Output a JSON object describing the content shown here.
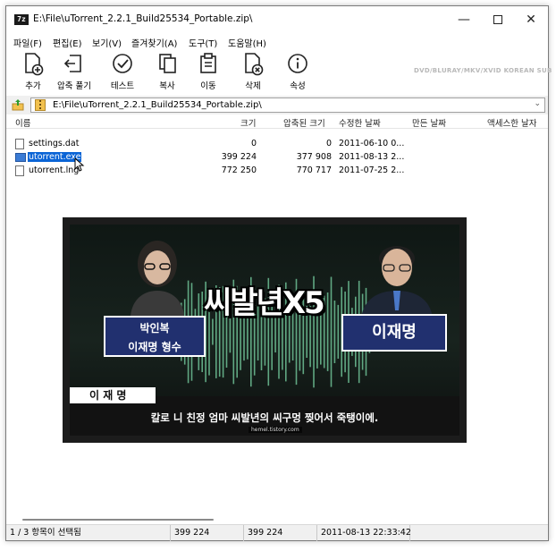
{
  "window": {
    "title": "E:\\File\\uTorrent_2.2.1_Build25534_Portable.zip\\",
    "app_icon_text": "7z",
    "minimize_glyph": "—",
    "close_glyph": "✕"
  },
  "menu": [
    "파일(F)",
    "편집(E)",
    "보기(V)",
    "즐겨찾기(A)",
    "도구(T)",
    "도움말(H)"
  ],
  "toolbar": {
    "items": [
      {
        "label": "추가",
        "icon": "add-icon"
      },
      {
        "label": "압축 풀기",
        "icon": "extract-icon"
      },
      {
        "label": "테스트",
        "icon": "test-icon"
      },
      {
        "label": "복사",
        "icon": "copy-icon"
      },
      {
        "label": "이동",
        "icon": "move-icon"
      },
      {
        "label": "삭제",
        "icon": "delete-icon"
      },
      {
        "label": "속성",
        "icon": "info-icon"
      }
    ],
    "watermark": "DVD/BLURAY/MKV/XVID KOREAN SUB"
  },
  "address": {
    "path": "E:\\File\\uTorrent_2.2.1_Build25534_Portable.zip\\",
    "dropdown_glyph": "⌄"
  },
  "columns": [
    "이름",
    "크기",
    "압축된 크기",
    "수정한 날짜",
    "만든 날짜",
    "액세스한 날자"
  ],
  "files": [
    {
      "name": "settings.dat",
      "size": "0",
      "packed": "0",
      "modified": "2011-06-10 0...",
      "selected": false,
      "icon": "file-icon"
    },
    {
      "name": "utorrent.exe",
      "size": "399 224",
      "packed": "377 908",
      "modified": "2011-08-13 2...",
      "selected": true,
      "icon": "exe-icon"
    },
    {
      "name": "utorrent.lng",
      "size": "772 250",
      "packed": "770 717",
      "modified": "2011-07-25 2...",
      "selected": false,
      "icon": "file-icon"
    }
  ],
  "status": {
    "selection": "1 / 3 항목이 선택됨",
    "size": "399 224",
    "packed": "399 224",
    "modified": "2011-08-13 22:33:42"
  },
  "thumbnail": {
    "headline": "씨발년X5",
    "left_caption_line1": "박인복",
    "left_caption_line2": "이재명 형수",
    "right_caption": "이재명",
    "name_tag": "이 재 명",
    "subtitle": "칼로 니 친정 엄마 씨발년의 씨구멍 찢어서 죽탱이에.",
    "site_label": "hemel.tistory.com"
  }
}
